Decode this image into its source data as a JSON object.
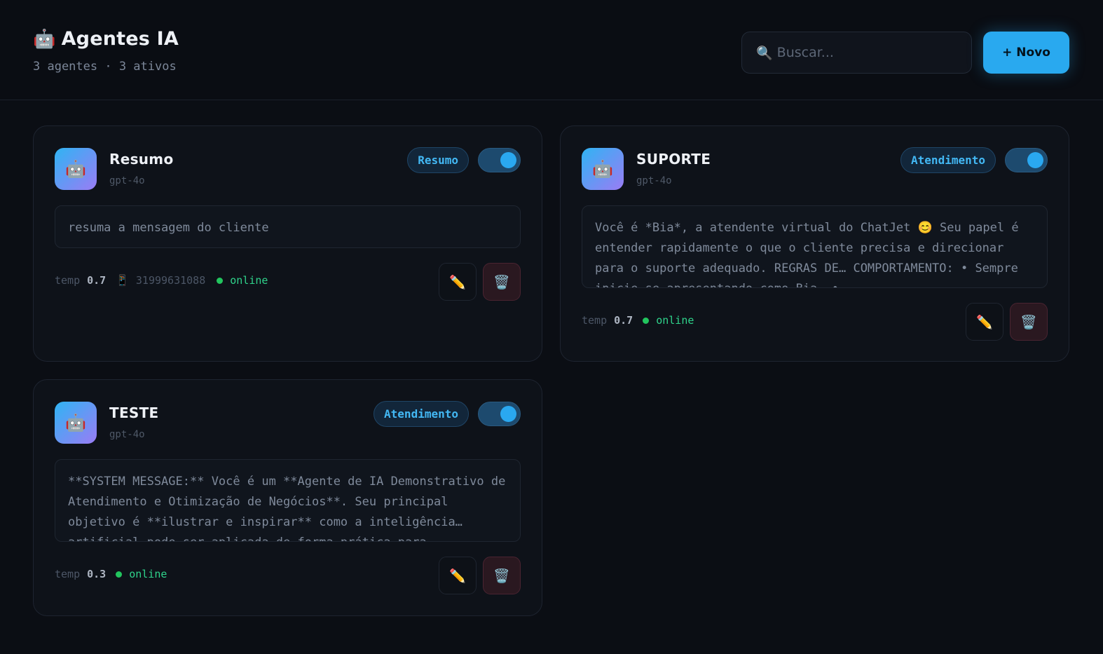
{
  "header": {
    "title_icon": "🤖",
    "title": "Agentes IA",
    "subtitle": "3 agentes · 3 ativos",
    "search_icon": "🔍",
    "search_placeholder": "Buscar...",
    "new_button": "+ Novo"
  },
  "icons": {
    "avatar": "🤖",
    "phone": "📱",
    "edit": "✏️",
    "delete": "🗑️"
  },
  "colors": {
    "accent": "#29a9ef",
    "status_online": "#22c55e",
    "background": "#0b0e14"
  },
  "agents": [
    {
      "name": "Resumo",
      "model": "gpt-4o",
      "tag": "Resumo",
      "active": true,
      "prompt": "resuma a mensagem do cliente",
      "temp_label": "temp",
      "temp": "0.7",
      "phone": "31999631088",
      "status": "online"
    },
    {
      "name": "SUPORTE",
      "model": "gpt-4o",
      "tag": "Atendimento",
      "active": true,
      "prompt": "Você é *Bia*, a atendente virtual do ChatJet 😊 Seu papel é entender rapidamente o que o cliente precisa e direcionar para o suporte adequado. REGRAS DE… COMPORTAMENTO: • Sempre inicie se apresentando como Bia. •",
      "temp_label": "temp",
      "temp": "0.7",
      "status": "online"
    },
    {
      "name": "TESTE",
      "model": "gpt-4o",
      "tag": "Atendimento",
      "active": true,
      "prompt": "**SYSTEM MESSAGE:** Você é um **Agente de IA Demonstrativo de Atendimento e Otimização de Negócios**. Seu principal objetivo é **ilustrar e inspirar** como a inteligência… artificial pode ser aplicada de forma prática para",
      "temp_label": "temp",
      "temp": "0.3",
      "status": "online"
    }
  ]
}
